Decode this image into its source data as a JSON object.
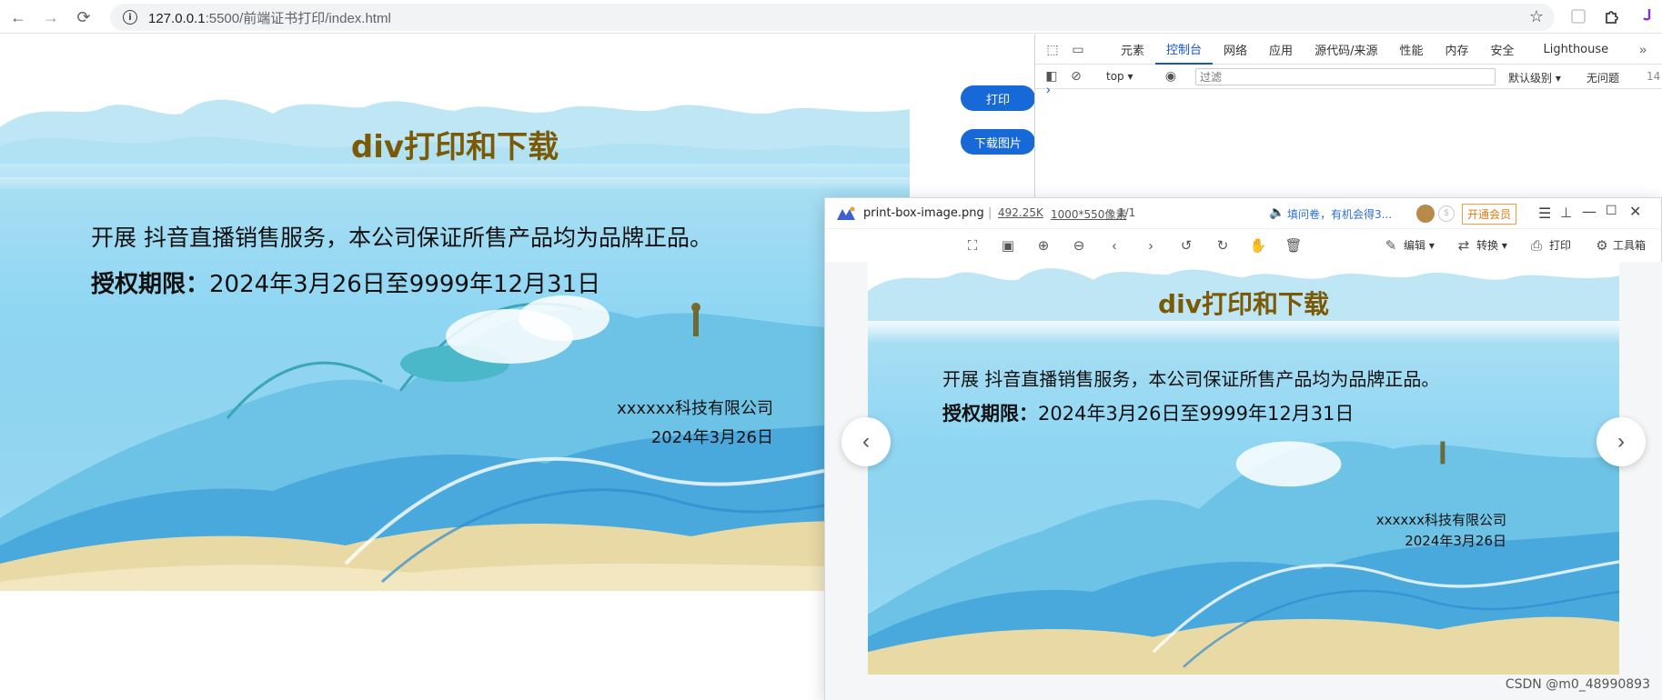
{
  "browser": {
    "url_host": "127.0.0.1",
    "url_rest": ":5500/前端证书打印/index.html"
  },
  "certificate": {
    "title": "div打印和下载",
    "line1": "开展 抖音直播销售服务，本公司保证所售产品均为品牌正品。",
    "period_label": "授权期限：",
    "period_value": "2024年3月26日至9999年12月31日",
    "company": "xxxxxx科技有限公司",
    "date": "2024年3月26日"
  },
  "page_buttons": {
    "print": "打印",
    "download": "下载图片"
  },
  "devtools": {
    "tabs": [
      "元素",
      "控制台",
      "网络",
      "应用",
      "源代码/来源",
      "性能",
      "内存",
      "安全",
      "Lighthouse"
    ],
    "active_tab": "控制台",
    "context": "top",
    "filter_placeholder": "过滤",
    "level": "默认级别",
    "issues": "无问题",
    "count": "14",
    "prompt": "›"
  },
  "viewer": {
    "filename": "print-box-image.png",
    "filesize": "492.25K",
    "dimensions": "1000*550像素",
    "page": "1/1",
    "promo": "填问卷，有机会得3...",
    "vip": "开通会员",
    "edit": "编辑",
    "convert": "转换",
    "print": "打印",
    "toolbox": "工具箱"
  },
  "watermark": "CSDN @m0_48990893",
  "colors": {
    "accent": "#1869d8",
    "title": "#7a5a06",
    "devtools_active": "#1a55c4"
  }
}
